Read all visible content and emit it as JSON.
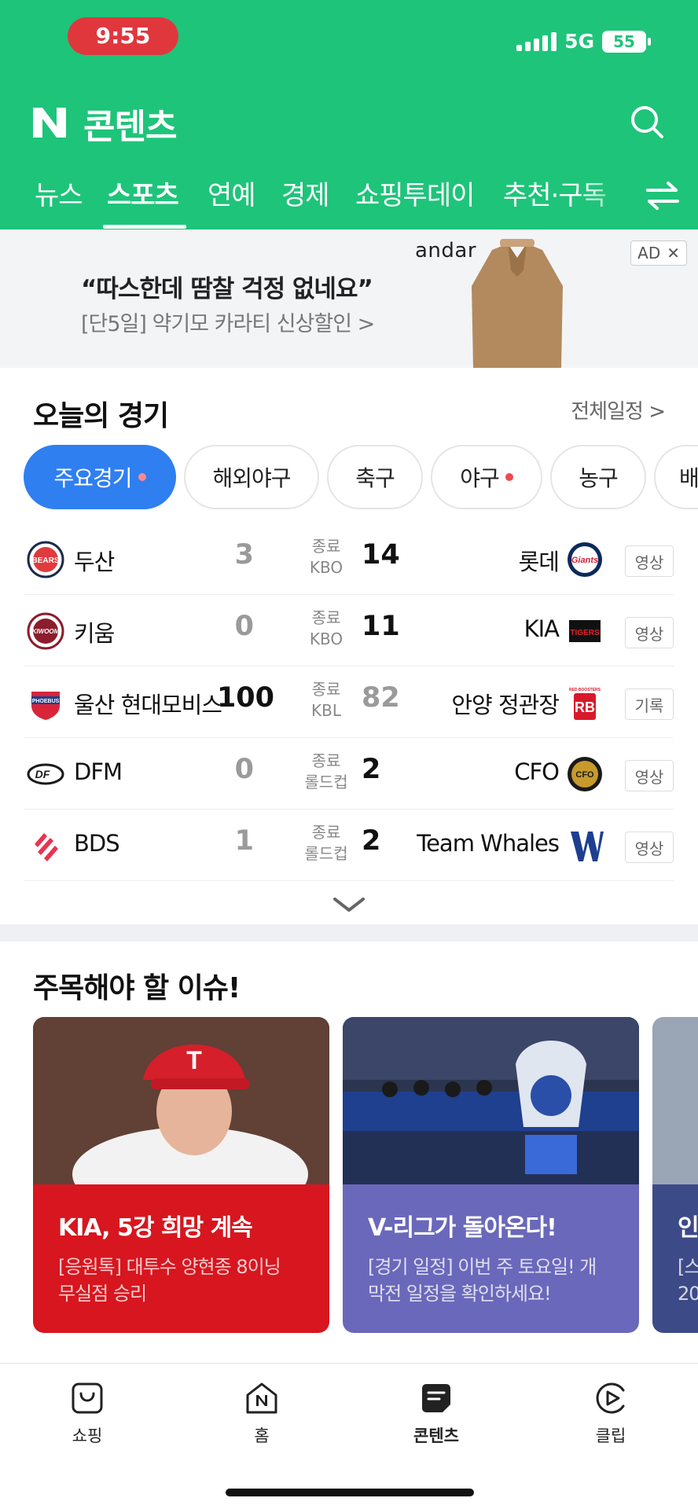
{
  "status_bar": {
    "time": "9:55",
    "network": "5G",
    "battery": "55"
  },
  "header": {
    "title": "콘텐츠",
    "tabs": [
      "뉴스",
      "스포츠",
      "연예",
      "경제",
      "쇼핑투데이",
      "추천·구독"
    ],
    "active_tab": "스포츠"
  },
  "ad": {
    "headline": "“따스한데 땀찰 걱정 없네요”",
    "subtext": "[단5일] 약기모 카라티 신상할인 >",
    "brand": "andar",
    "badge": "AD"
  },
  "today_games": {
    "title": "오늘의 경기",
    "schedule_link": "전체일정 >",
    "chips": [
      {
        "label": "주요경기",
        "dot": true
      },
      {
        "label": "해외야구",
        "dot": false
      },
      {
        "label": "축구",
        "dot": false
      },
      {
        "label": "야구",
        "dot": true
      },
      {
        "label": "농구",
        "dot": false
      },
      {
        "label": "배",
        "dot": false
      }
    ],
    "games": [
      {
        "home": "두산",
        "home_score": "3",
        "status": "종료",
        "league": "KBO",
        "away_score": "14",
        "away": "롯데",
        "winner": "away",
        "action": "영상"
      },
      {
        "home": "키움",
        "home_score": "0",
        "status": "종료",
        "league": "KBO",
        "away_score": "11",
        "away": "KIA",
        "winner": "away",
        "action": "영상"
      },
      {
        "home": "울산 현대모비스",
        "home_score": "100",
        "status": "종료",
        "league": "KBL",
        "away_score": "82",
        "away": "안양 정관장",
        "winner": "home",
        "action": "기록"
      },
      {
        "home": "DFM",
        "home_score": "0",
        "status": "종료",
        "league": "롤드컵",
        "away_score": "2",
        "away": "CFO",
        "winner": "away",
        "action": "영상"
      },
      {
        "home": "BDS",
        "home_score": "1",
        "status": "종료",
        "league": "롤드컵",
        "away_score": "2",
        "away": "Team Whales",
        "winner": "away",
        "action": "영상"
      }
    ],
    "logo_texts": {
      "bears": "BEARS",
      "giants": "Giants",
      "kiwoom": "KIWOOM",
      "tigers": "TIGERS",
      "phoebus": "PHOEBUS",
      "redboosters": "RED BOOSTERS",
      "dfm": "DF",
      "cfo": "CFO"
    }
  },
  "issues": {
    "title": "주목해야 할 이슈!",
    "cards": [
      {
        "title": "KIA, 5강 희망 계속",
        "desc_line1": "[응원톡] 대투수 양현종 8이닝",
        "desc_line2": "무실점 승리",
        "cap_letter": "T"
      },
      {
        "title": "V-리그가 돌아온다!",
        "desc_line1": "[경기 일정] 이번 주 토요일! 개",
        "desc_line2": "막전 일정을 확인하세요!"
      },
      {
        "title": "인",
        "desc_line1": "[스",
        "desc_line2": "20"
      }
    ]
  },
  "bottom_nav": {
    "items": [
      "쇼핑",
      "홈",
      "콘텐츠",
      "클립"
    ],
    "active": "콘텐츠"
  },
  "colors": {
    "brand_green": "#1ec47a",
    "active_chip": "#2f7ff0",
    "card_red": "#d7161f",
    "card_purple": "#6a68ba",
    "live_dot": "#f0484f"
  }
}
